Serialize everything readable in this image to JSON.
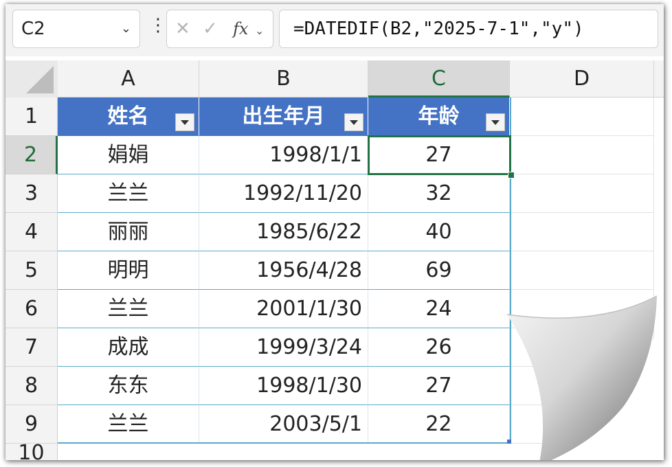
{
  "name_box": {
    "value": "C2"
  },
  "formula_bar": {
    "formula": "=DATEDIF(B2,\"2025-7-1\",\"y\")",
    "fx_label": "fx"
  },
  "columns": [
    "A",
    "B",
    "C",
    "D"
  ],
  "rows": [
    "1",
    "2",
    "3",
    "4",
    "5",
    "6",
    "7",
    "8",
    "9",
    "10"
  ],
  "table": {
    "headers": [
      "姓名",
      "出生年月",
      "年龄"
    ],
    "data": [
      [
        "娟娟",
        "1998/1/1",
        "27"
      ],
      [
        "兰兰",
        "1992/11/20",
        "32"
      ],
      [
        "丽丽",
        "1985/6/22",
        "40"
      ],
      [
        "明明",
        "1956/4/28",
        "69"
      ],
      [
        "兰兰",
        "2001/1/30",
        "24"
      ],
      [
        "成成",
        "1999/3/24",
        "26"
      ],
      [
        "东东",
        "1998/1/30",
        "27"
      ],
      [
        "兰兰",
        "2003/5/1",
        "22"
      ]
    ]
  },
  "colors": {
    "header_fill": "#4472c4",
    "selection": "#217346",
    "table_border": "#5aa9c9"
  }
}
